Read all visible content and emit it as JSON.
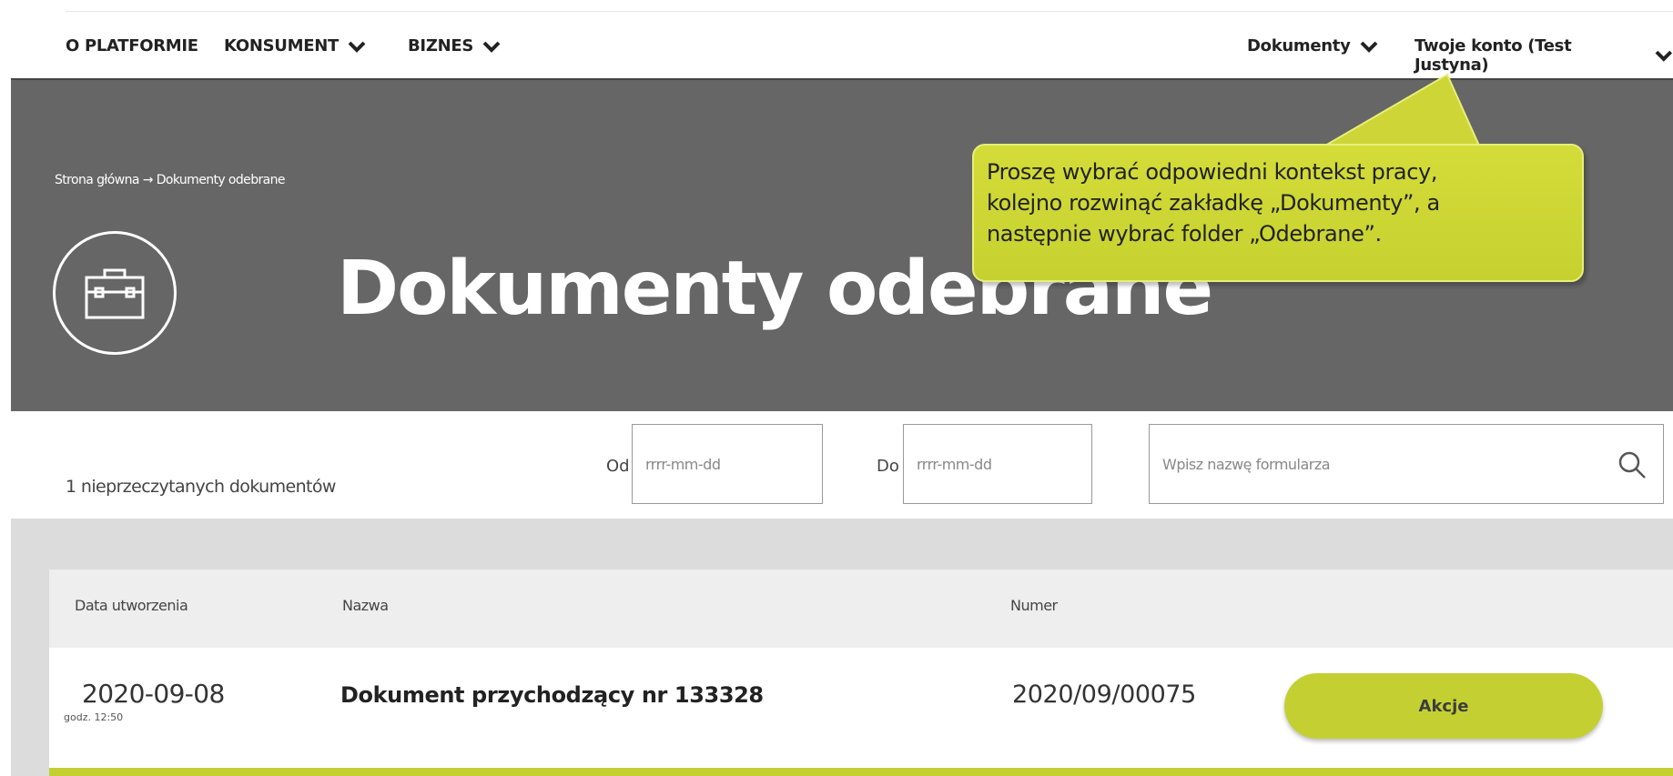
{
  "nav": {
    "o_platformie": "O PLATFORMIE",
    "konsument": "KONSUMENT",
    "biznes": "BIZNES",
    "dokumenty": "Dokumenty",
    "konto": "Twoje konto (Test Justyna)"
  },
  "breadcrumb": {
    "home": "Strona główna",
    "arrow": "→",
    "current": "Dokumenty odebrane"
  },
  "page_title": "Dokumenty odebrane",
  "callout": {
    "line1": "Proszę wybrać odpowiedni kontekst pracy,",
    "line2": "kolejno rozwinąć zakładkę „Dokumenty”, a",
    "line3": "następnie wybrać folder „Odebrane”.",
    "color": "#cdd636"
  },
  "filters": {
    "unread": "1 nieprzeczytanych dokumentów",
    "from_label": "Od",
    "from_placeholder": "rrrr-mm-dd",
    "to_label": "Do",
    "to_placeholder": "rrrr-mm-dd",
    "search_placeholder": "Wpisz nazwę formularza"
  },
  "table": {
    "headers": {
      "date": "Data utworzenia",
      "name": "Nazwa",
      "number": "Numer"
    },
    "rows": [
      {
        "date": "2020-09-08",
        "time": "godz. 12:50",
        "name": "Dokument przychodzący nr 133328",
        "number": "2020/09/00075",
        "action": "Akcje"
      }
    ]
  },
  "colors": {
    "accent": "#c4d032",
    "hero_bg": "#666666",
    "list_bg": "#dcdcdc"
  }
}
